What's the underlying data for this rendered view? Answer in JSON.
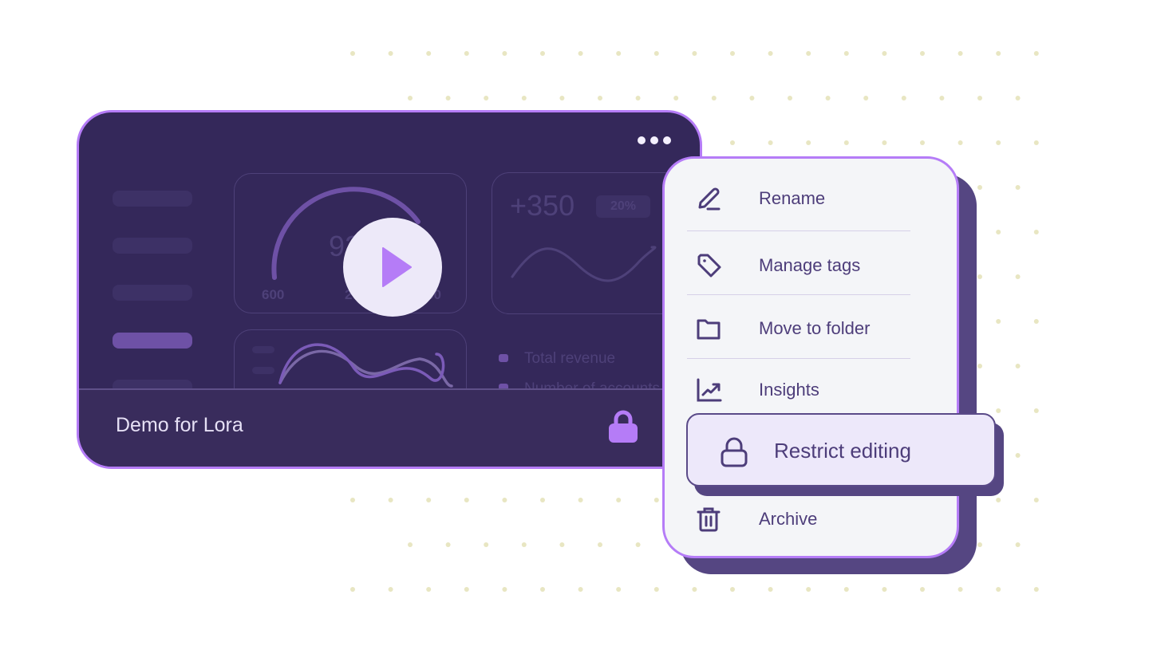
{
  "card": {
    "title": "Demo for Lora",
    "more_icon": "more-horizontal-icon",
    "lock_icon": "lock-filled-icon",
    "play_icon": "play-icon",
    "preview": {
      "gauge": {
        "value_partial": "92",
        "min_label": "600",
        "mid_label": "2",
        "max_label": "50"
      },
      "stat": {
        "value": "+350",
        "badge": "20%"
      },
      "legend": [
        "Total revenue",
        "Number of accounts"
      ]
    }
  },
  "menu": {
    "items": [
      {
        "label": "Rename",
        "icon": "pencil-icon"
      },
      {
        "label": "Manage tags",
        "icon": "tag-icon"
      },
      {
        "label": "Move to folder",
        "icon": "folder-icon"
      },
      {
        "label": "Insights",
        "icon": "trending-chart-icon"
      },
      {
        "label": "Restrict editing",
        "icon": "lock-icon",
        "highlighted": true
      },
      {
        "label": "Archive",
        "icon": "trash-icon"
      }
    ]
  },
  "colors": {
    "card_bg": "#34285a",
    "accent": "#b57cf7",
    "menu_text": "#4d3d7a",
    "menu_shadow": "#554682",
    "dots": "#e8e6c2"
  }
}
